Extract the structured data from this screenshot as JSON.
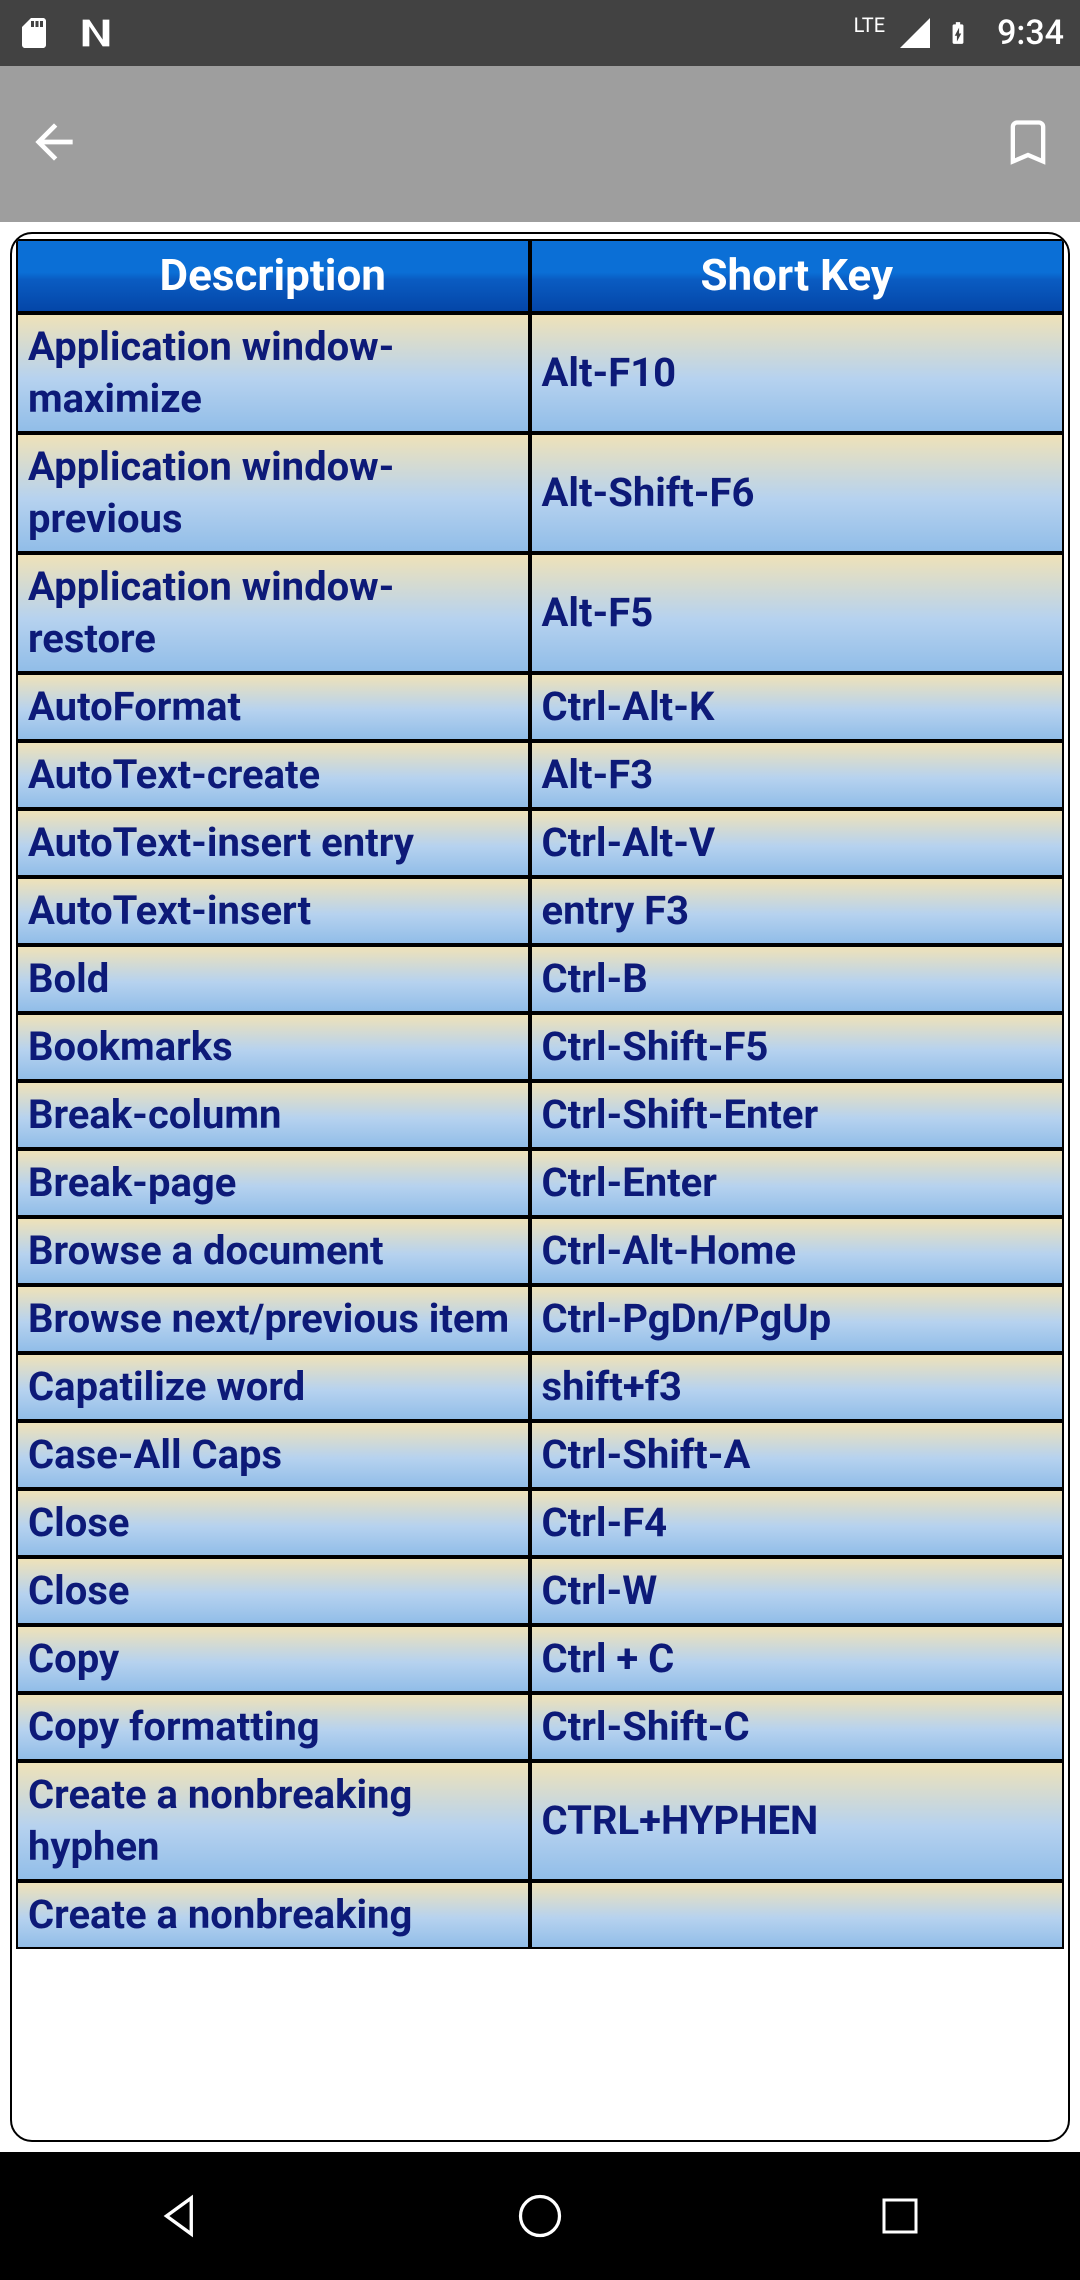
{
  "status": {
    "time": "9:34",
    "network": "LTE"
  },
  "table": {
    "headers": {
      "description": "Description",
      "shortkey": "Short Key"
    },
    "rows": [
      {
        "desc": "Application window-maximize",
        "key": "Alt-F10"
      },
      {
        "desc": "Application window-previous",
        "key": "Alt-Shift-F6"
      },
      {
        "desc": "Application window-restore",
        "key": "Alt-F5"
      },
      {
        "desc": "AutoFormat",
        "key": "Ctrl-Alt-K"
      },
      {
        "desc": "AutoText-create",
        "key": "Alt-F3"
      },
      {
        "desc": "AutoText-insert entry",
        "key": "Ctrl-Alt-V"
      },
      {
        "desc": "AutoText-insert",
        "key": "entry F3"
      },
      {
        "desc": "Bold",
        "key": "Ctrl-B"
      },
      {
        "desc": "Bookmarks",
        "key": "Ctrl-Shift-F5"
      },
      {
        "desc": "Break-column",
        "key": "Ctrl-Shift-Enter"
      },
      {
        "desc": "Break-page",
        "key": "Ctrl-Enter"
      },
      {
        "desc": "Browse a document",
        "key": "Ctrl-Alt-Home"
      },
      {
        "desc": "Browse next/previous item",
        "key": "Ctrl-PgDn/PgUp"
      },
      {
        "desc": "Capatilize word",
        "key": "shift+f3"
      },
      {
        "desc": "Case-All Caps",
        "key": "Ctrl-Shift-A"
      },
      {
        "desc": "Close",
        "key": "Ctrl-F4"
      },
      {
        "desc": "Close",
        "key": "Ctrl-W"
      },
      {
        "desc": "Copy",
        "key": "Ctrl + C"
      },
      {
        "desc": "Copy formatting",
        "key": "Ctrl-Shift-C"
      },
      {
        "desc": "Create a nonbreaking hyphen",
        "key": "CTRL+HYPHEN"
      },
      {
        "desc": "Create a nonbreaking",
        "key": ""
      }
    ]
  }
}
